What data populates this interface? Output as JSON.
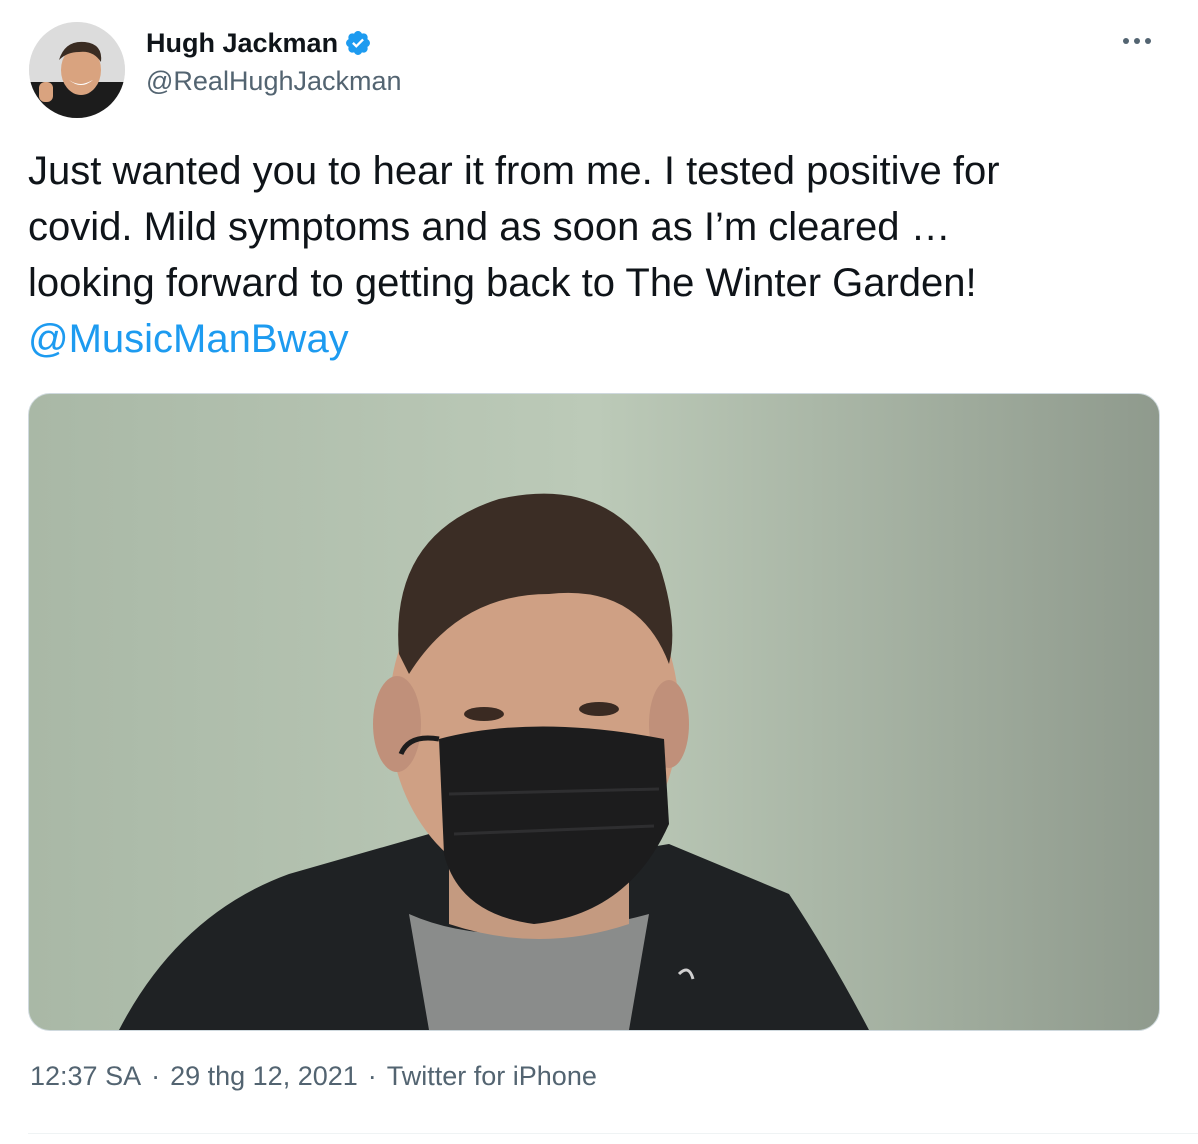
{
  "author": {
    "name": "Hugh Jackman",
    "handle": "@RealHughJackman",
    "verified": true,
    "avatar_icon": "profile-photo"
  },
  "tweet": {
    "text_lines": [
      "Just wanted you to hear it from me. I tested positive for",
      "covid. Mild symptoms and as soon as I’m cleared …",
      "looking forward to getting back to The Winter Garden!"
    ],
    "mention": "@MusicManBway"
  },
  "media": {
    "type": "video-still",
    "description_icon": "video-thumbnail"
  },
  "meta": {
    "time": "12:37 SA",
    "separator": "·",
    "date": "29 thg 12, 2021",
    "source": "Twitter for iPhone"
  },
  "colors": {
    "link": "#1d9bf0",
    "secondary_text": "#536471",
    "verified_badge": "#1d9bf0"
  }
}
